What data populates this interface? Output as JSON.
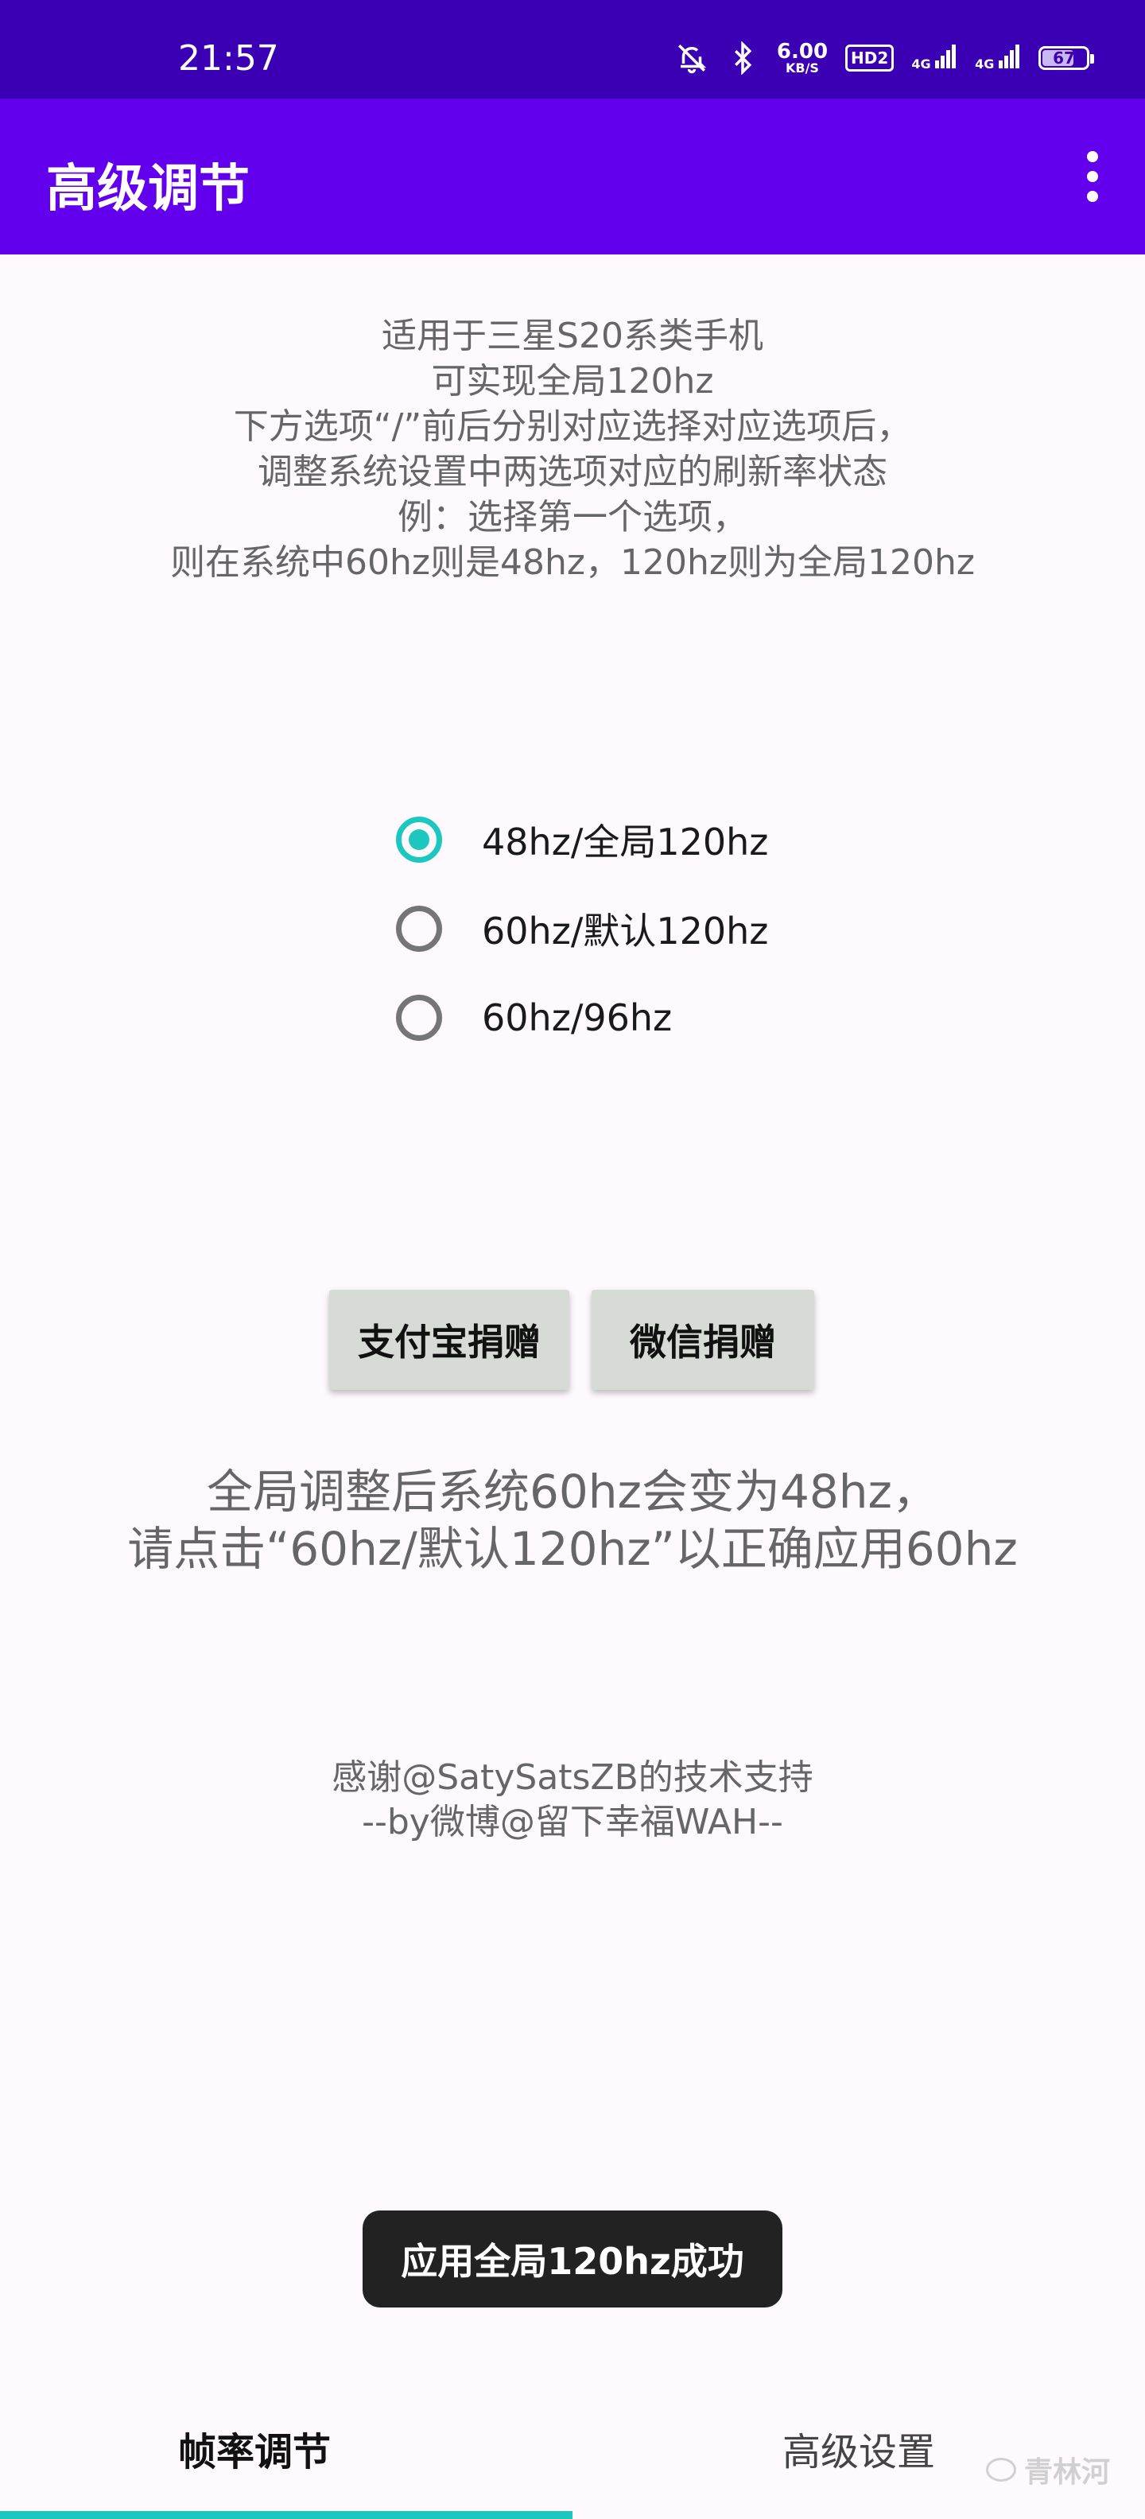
{
  "status_bar": {
    "time": "21:57",
    "net_speed_value": "6.00",
    "net_speed_unit": "KB/S",
    "hd_badge": "HD2",
    "signal_1": "4G",
    "signal_2": "4G",
    "battery_level": "67",
    "icons": [
      "mute-icon",
      "bluetooth-icon",
      "signal-icon",
      "signal-icon",
      "battery-icon"
    ]
  },
  "app_bar": {
    "title": "高级调节",
    "menu_icon": "overflow-menu-icon"
  },
  "intro_lines": [
    "适用于三星S20系类手机",
    "可实现全局120hz",
    "下方选项“/”前后分别对应选择对应选项后，",
    "调整系统设置中两选项对应的刷新率状态",
    "例：选择第一个选项，",
    "则在系统中60hz则是48hz，120hz则为全局120hz"
  ],
  "radio_options": [
    {
      "label": "48hz/全局120hz",
      "selected": true
    },
    {
      "label": "60hz/默认120hz",
      "selected": false
    },
    {
      "label": "60hz/96hz",
      "selected": false
    }
  ],
  "buttons": {
    "alipay": "支付宝捐赠",
    "wechat": "微信捐赠"
  },
  "warning_lines": [
    "全局调整后系统60hz会变为48hz，",
    "请点击“60hz/默认120hz”以正确应用60hz"
  ],
  "credits_lines": [
    "感谢@SatySatsZB的技术支持",
    "--by微博@留下幸福WAH--"
  ],
  "toast": "应用全局120hz成功",
  "tabs": [
    {
      "label": "帧率调节",
      "active": true
    },
    {
      "label": "高级设置",
      "active": false
    }
  ],
  "watermark": "青林河",
  "colors": {
    "status_bar": "#3b00b4",
    "app_bar": "#6200ee",
    "accent": "#1cc8bd",
    "background": "#fdf9fd",
    "button": "#d7dbd6",
    "toast": "#222222"
  }
}
